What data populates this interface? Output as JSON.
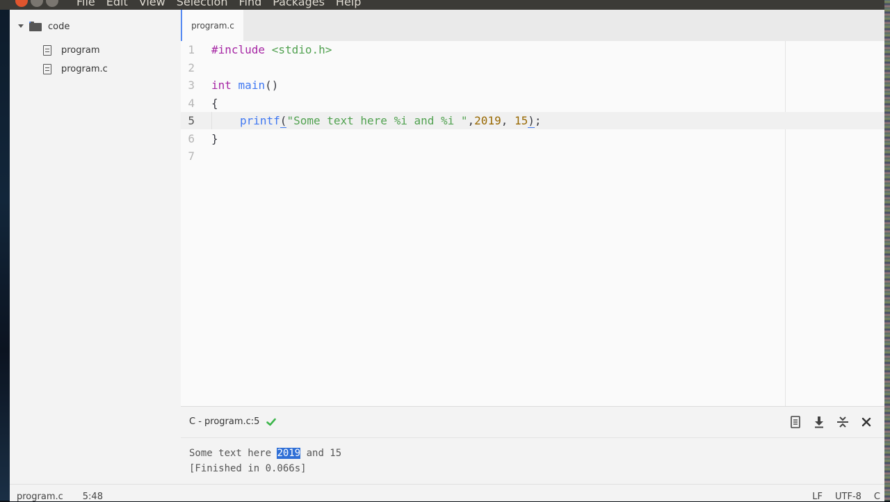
{
  "menubar": {
    "items": [
      "File",
      "Edit",
      "View",
      "Selection",
      "Find",
      "Packages",
      "Help"
    ]
  },
  "sidebar": {
    "root": "code",
    "files": [
      "program",
      "program.c"
    ]
  },
  "editor": {
    "tab_title": "program.c",
    "line_numbers": [
      "1",
      "2",
      "3",
      "4",
      "5",
      "6",
      "7"
    ],
    "lines": {
      "l1_directive": "#include",
      "l1_header": "<stdio.h>",
      "l3_type": "int",
      "l3_fn": "main",
      "l3_parens": "()",
      "l4": "{",
      "l5_fn": "printf",
      "l5_open": "(",
      "l5_string": "\"Some text here %i and %i \"",
      "l5_comma1": ",",
      "l5_num1": "2019",
      "l5_comma2": ", ",
      "l5_num2": "15",
      "l5_close": ")",
      "l5_semi": ";",
      "l6": "}"
    }
  },
  "panel": {
    "title": "C - program.c:5",
    "output_pre": "Some text here ",
    "output_sel": "2019",
    "output_post": " and 15",
    "output_line2": "[Finished in 0.066s]"
  },
  "statusbar": {
    "file": "program.c",
    "cursor": "5:48",
    "line_ending": "LF",
    "encoding": "UTF-8",
    "grammar": "C"
  },
  "colors": {
    "accent": "#568af2",
    "success": "#3bb54a",
    "selection": "#2f6fd6"
  }
}
